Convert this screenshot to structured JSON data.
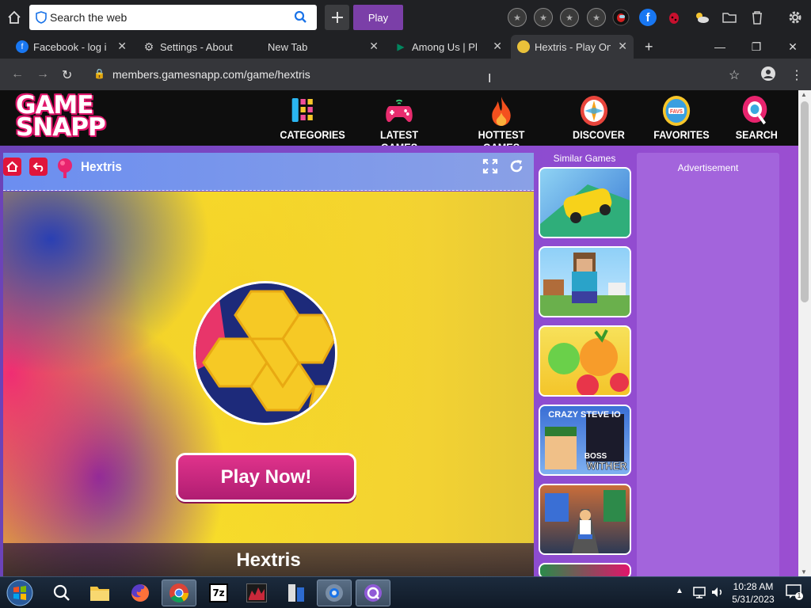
{
  "topbar": {
    "search_placeholder": "Search the web",
    "play_label": "Play"
  },
  "tabs": [
    {
      "label": "Facebook - log in",
      "favicon_color": "#1877f2"
    },
    {
      "label": "Settings - About C",
      "favicon_color": "#cccccc"
    },
    {
      "label": "New Tab",
      "favicon_color": ""
    },
    {
      "label": "Among Us | Pl",
      "favicon_color": "#01875f"
    },
    {
      "label": "Hextris - Play Onli",
      "favicon_color": "#e9c13a"
    }
  ],
  "address": {
    "url": "members.gamesnapp.com/game/hextris"
  },
  "site": {
    "logo_line1": "GAME",
    "logo_line2": "SNAPP",
    "menu": [
      {
        "label": "CATEGORIES",
        "icon": "categories-icon"
      },
      {
        "label": "LATEST GAMES",
        "icon": "gamepad-icon"
      },
      {
        "label": "HOTTEST GAMES",
        "icon": "fire-icon"
      },
      {
        "label": "DISCOVER",
        "icon": "compass-icon"
      },
      {
        "label": "FAVORITES",
        "icon": "favs-icon"
      },
      {
        "label": "SEARCH",
        "icon": "search-icon"
      }
    ],
    "game_title": "Hextris",
    "play_now": "Play Now!",
    "bottom_title": "Hextris",
    "similar_games": "Similar Games",
    "thumbs": [
      "car-race-game",
      "minecraft-game",
      "fruit-match-game",
      "crazy-steve-game",
      "subway-run-game"
    ],
    "crazy_steve_text": "CRAZY STEVE IO",
    "boss_text": "BOSS",
    "wither_text": "WITHER",
    "advertisement": "Advertisement"
  },
  "taskbar": {
    "time": "10:28 AM",
    "date": "5/31/2023",
    "notif_count": "1"
  },
  "colors": {
    "brand_pink": "#e0156b",
    "purple_bg": "#8a4bd0",
    "play_purple": "#7b3fa8"
  }
}
